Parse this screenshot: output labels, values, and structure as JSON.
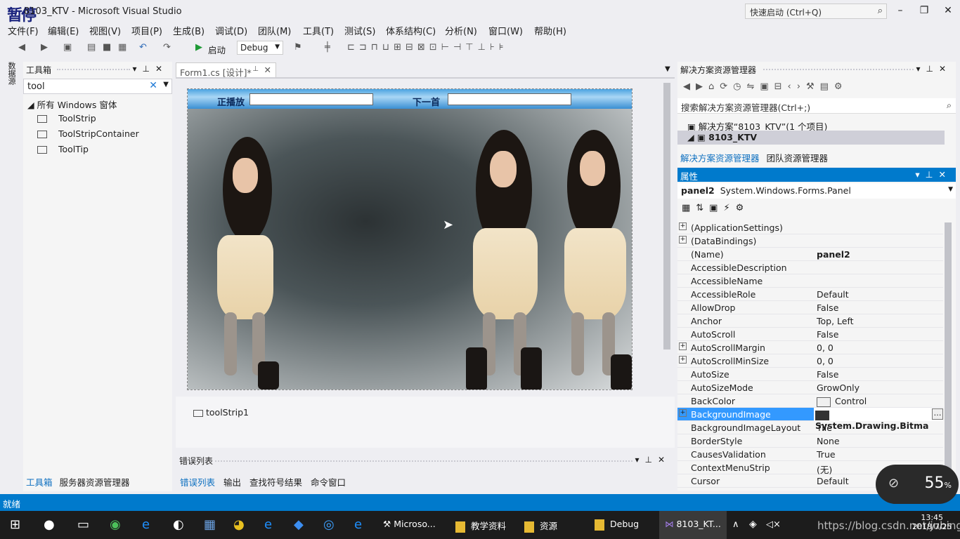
{
  "titlebar": {
    "overlay_label": "暂停",
    "title": "8103_KTV - Microsoft Visual Studio",
    "quick_launch": "快速启动 (Ctrl+Q)"
  },
  "menu": [
    "文件(F)",
    "编辑(E)",
    "视图(V)",
    "项目(P)",
    "生成(B)",
    "调试(D)",
    "团队(M)",
    "工具(T)",
    "测试(S)",
    "体系结构(C)",
    "分析(N)",
    "窗口(W)",
    "帮助(H)"
  ],
  "toolbar": {
    "start_label": "启动",
    "config": "Debug"
  },
  "left_vertical_tab": "数据源",
  "toolbox": {
    "title": "工具箱",
    "search": "tool",
    "group": "所有 Windows 窗体",
    "items": [
      "ToolStrip",
      "ToolStripContainer",
      "ToolTip"
    ],
    "tabs": [
      "工具箱",
      "服务器资源管理器"
    ]
  },
  "designer": {
    "tab_label": "Form1.cs [设计]*",
    "header_labels": [
      "正播放",
      "下一首"
    ],
    "tray_item": "toolStrip1"
  },
  "error_list": {
    "title": "错误列表",
    "tabs": [
      "错误列表",
      "输出",
      "查找符号结果",
      "命令窗口"
    ]
  },
  "solution_explorer": {
    "title": "解决方案资源管理器",
    "search": "搜索解决方案资源管理器(Ctrl+;)",
    "solution": "解决方案“8103_KTV”(1 个项目)",
    "project": "8103_KTV",
    "tabs": [
      "解决方案资源管理器",
      "团队资源管理器"
    ]
  },
  "properties": {
    "title": "属性",
    "object": "panel2",
    "object_type": "System.Windows.Forms.Panel",
    "rows": [
      {
        "name": "(ApplicationSettings)",
        "value": "",
        "expandable": true
      },
      {
        "name": "(DataBindings)",
        "value": "",
        "expandable": true
      },
      {
        "name": "(Name)",
        "value": "panel2",
        "bold": true
      },
      {
        "name": "AccessibleDescription",
        "value": ""
      },
      {
        "name": "AccessibleName",
        "value": ""
      },
      {
        "name": "AccessibleRole",
        "value": "Default"
      },
      {
        "name": "AllowDrop",
        "value": "False"
      },
      {
        "name": "Anchor",
        "value": "Top, Left"
      },
      {
        "name": "AutoScroll",
        "value": "False"
      },
      {
        "name": "AutoScrollMargin",
        "value": "0, 0",
        "expandable": true
      },
      {
        "name": "AutoScrollMinSize",
        "value": "0, 0",
        "expandable": true
      },
      {
        "name": "AutoSize",
        "value": "False"
      },
      {
        "name": "AutoSizeMode",
        "value": "GrowOnly"
      },
      {
        "name": "BackColor",
        "value": "Control",
        "swatch": "color"
      },
      {
        "name": "BackgroundImage",
        "value": "System.Drawing.Bitma",
        "swatch": "image",
        "selected": true,
        "expandable": true
      },
      {
        "name": "BackgroundImageLayout",
        "value": "Tile"
      },
      {
        "name": "BorderStyle",
        "value": "None"
      },
      {
        "name": "CausesValidation",
        "value": "True"
      },
      {
        "name": "ContextMenuStrip",
        "value": "(无)"
      },
      {
        "name": "Cursor",
        "value": "Default"
      }
    ]
  },
  "statusbar": {
    "text": "就绪"
  },
  "overlay": {
    "percent": "55",
    "unit": "%"
  },
  "taskbar": {
    "apps": [
      "Microso...",
      "教学资料",
      "资源",
      "Debug",
      "8103_KT..."
    ],
    "watermark": "https://blog.csdn.net/jubing",
    "time": "13:45",
    "date": "2018/7/25"
  },
  "colors": {
    "accent": "#007acc",
    "selection": "#3399ff",
    "header_blue": "#4ba3e0"
  }
}
